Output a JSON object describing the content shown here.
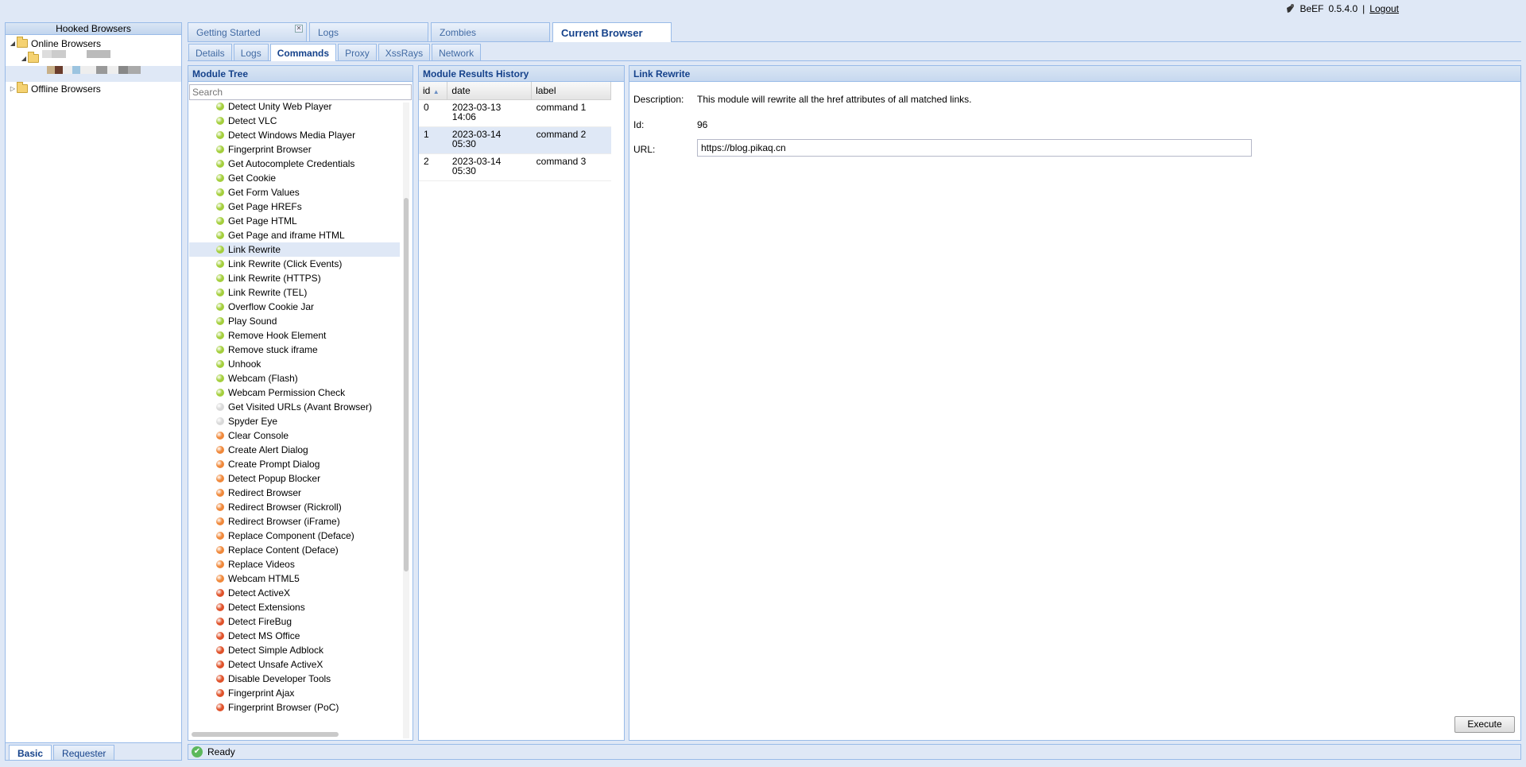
{
  "top": {
    "app": "BeEF",
    "version": "0.5.4.0",
    "sep": "|",
    "logout": "Logout"
  },
  "left": {
    "title": "Hooked Browsers",
    "online": "Online Browsers",
    "offline": "Offline Browsers",
    "tabs": [
      "Basic",
      "Requester"
    ]
  },
  "main_tabs": [
    "Getting Started",
    "Logs",
    "Zombies",
    "Current Browser"
  ],
  "sub_tabs": [
    "Details",
    "Logs",
    "Commands",
    "Proxy",
    "XssRays",
    "Network"
  ],
  "module_tree": {
    "title": "Module Tree",
    "search_placeholder": "Search",
    "items": [
      {
        "label": "Detect Unity Web Player",
        "color": "#a4cf3c"
      },
      {
        "label": "Detect VLC",
        "color": "#a4cf3c"
      },
      {
        "label": "Detect Windows Media Player",
        "color": "#a4cf3c"
      },
      {
        "label": "Fingerprint Browser",
        "color": "#a4cf3c"
      },
      {
        "label": "Get Autocomplete Credentials",
        "color": "#a4cf3c"
      },
      {
        "label": "Get Cookie",
        "color": "#a4cf3c"
      },
      {
        "label": "Get Form Values",
        "color": "#a4cf3c"
      },
      {
        "label": "Get Page HREFs",
        "color": "#a4cf3c"
      },
      {
        "label": "Get Page HTML",
        "color": "#a4cf3c"
      },
      {
        "label": "Get Page and iframe HTML",
        "color": "#a4cf3c"
      },
      {
        "label": "Link Rewrite",
        "color": "#a4cf3c",
        "selected": true
      },
      {
        "label": "Link Rewrite (Click Events)",
        "color": "#a4cf3c"
      },
      {
        "label": "Link Rewrite (HTTPS)",
        "color": "#a4cf3c"
      },
      {
        "label": "Link Rewrite (TEL)",
        "color": "#a4cf3c"
      },
      {
        "label": "Overflow Cookie Jar",
        "color": "#a4cf3c"
      },
      {
        "label": "Play Sound",
        "color": "#a4cf3c"
      },
      {
        "label": "Remove Hook Element",
        "color": "#a4cf3c"
      },
      {
        "label": "Remove stuck iframe",
        "color": "#a4cf3c"
      },
      {
        "label": "Unhook",
        "color": "#a4cf3c"
      },
      {
        "label": "Webcam (Flash)",
        "color": "#a4cf3c"
      },
      {
        "label": "Webcam Permission Check",
        "color": "#a4cf3c"
      },
      {
        "label": "Get Visited URLs (Avant Browser)",
        "color": "#d9d9d9"
      },
      {
        "label": "Spyder Eye",
        "color": "#d9d9d9"
      },
      {
        "label": "Clear Console",
        "color": "#f0883a"
      },
      {
        "label": "Create Alert Dialog",
        "color": "#f0883a"
      },
      {
        "label": "Create Prompt Dialog",
        "color": "#f0883a"
      },
      {
        "label": "Detect Popup Blocker",
        "color": "#f0883a"
      },
      {
        "label": "Redirect Browser",
        "color": "#f0883a"
      },
      {
        "label": "Redirect Browser (Rickroll)",
        "color": "#f0883a"
      },
      {
        "label": "Redirect Browser (iFrame)",
        "color": "#f0883a"
      },
      {
        "label": "Replace Component (Deface)",
        "color": "#f0883a"
      },
      {
        "label": "Replace Content (Deface)",
        "color": "#f0883a"
      },
      {
        "label": "Replace Videos",
        "color": "#f0883a"
      },
      {
        "label": "Webcam HTML5",
        "color": "#f0883a"
      },
      {
        "label": "Detect ActiveX",
        "color": "#e0522a"
      },
      {
        "label": "Detect Extensions",
        "color": "#e0522a"
      },
      {
        "label": "Detect FireBug",
        "color": "#e0522a"
      },
      {
        "label": "Detect MS Office",
        "color": "#e0522a"
      },
      {
        "label": "Detect Simple Adblock",
        "color": "#e0522a"
      },
      {
        "label": "Detect Unsafe ActiveX",
        "color": "#e0522a"
      },
      {
        "label": "Disable Developer Tools",
        "color": "#e0522a"
      },
      {
        "label": "Fingerprint Ajax",
        "color": "#e0522a"
      },
      {
        "label": "Fingerprint Browser (PoC)",
        "color": "#e0522a"
      }
    ]
  },
  "results": {
    "title": "Module Results History",
    "columns": [
      "id",
      "date",
      "label"
    ],
    "rows": [
      {
        "id": "0",
        "date1": "2023-03-13",
        "date2": "14:06",
        "label": "command 1"
      },
      {
        "id": "1",
        "date1": "2023-03-14",
        "date2": "05:30",
        "label": "command 2"
      },
      {
        "id": "2",
        "date1": "2023-03-14",
        "date2": "05:30",
        "label": "command 3"
      }
    ]
  },
  "detail": {
    "title": "Link Rewrite",
    "desc_label": "Description:",
    "desc": "This module will rewrite all the href attributes of all matched links.",
    "id_label": "Id:",
    "id": "96",
    "url_label": "URL:",
    "url": "https://blog.pikaq.cn",
    "execute": "Execute"
  },
  "status": "Ready"
}
